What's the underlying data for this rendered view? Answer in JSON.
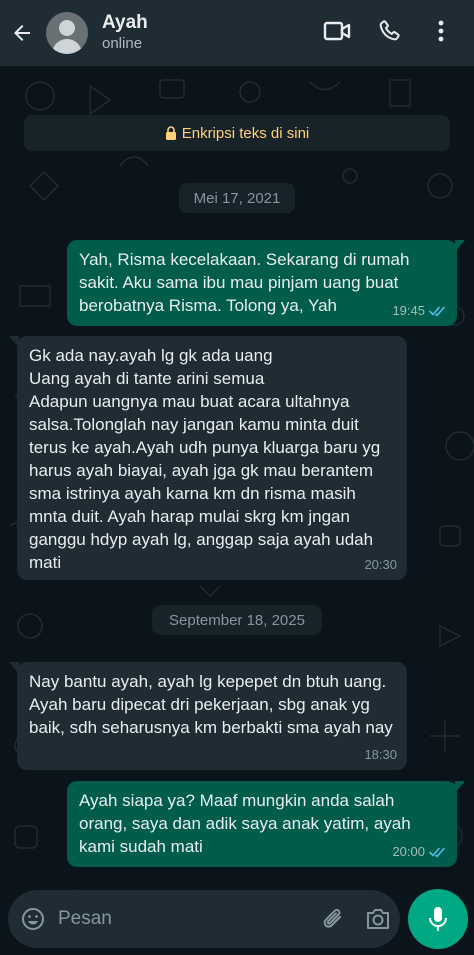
{
  "header": {
    "contact_name": "Ayah",
    "status": "online",
    "icons": [
      "back-arrow-icon",
      "video-call-icon",
      "voice-call-icon",
      "more-options-icon"
    ]
  },
  "encryption_notice": "Enkripsi teks di sini",
  "dates": {
    "first": "Mei 17, 2021",
    "second": "September 18, 2025"
  },
  "messages": [
    {
      "direction": "outgoing",
      "text": "Yah, Risma kecelakaan. Sekarang di rumah sakit. Aku sama ibu mau pinjam uang  buat berobatnya Risma. Tolong ya, Yah",
      "time": "19:45",
      "read": true
    },
    {
      "direction": "incoming",
      "text": "Gk ada nay.ayah lg gk ada uang\nUang ayah di tante arini semua\nAdapun uangnya mau buat acara ultahnya salsa.Tolonglah nay jangan kamu minta duit terus ke ayah.Ayah udh punya kluarga baru yg harus ayah biayai, ayah jga gk mau berantem sma istrinya ayah karna km dn risma masih mnta duit. Ayah harap mulai skrg km jngan ganggu hdyp ayah lg, anggap saja ayah udah mati",
      "time": "20:30"
    },
    {
      "direction": "incoming",
      "text": "Nay bantu ayah, ayah lg kepepet dn btuh uang. Ayah baru dipecat dri pekerjaan, sbg anak yg baik, sdh seharusnya km berbakti sma ayah nay",
      "time": "18:30"
    },
    {
      "direction": "outgoing",
      "text": "Ayah siapa ya? Maaf mungkin anda salah orang, saya dan adik saya anak yatim, ayah kami sudah mati",
      "time": "20:00",
      "read": true
    }
  ],
  "composer": {
    "placeholder": "Pesan",
    "icons": [
      "emoji-icon",
      "attach-icon",
      "camera-icon",
      "mic-icon"
    ]
  },
  "colors": {
    "header_bg": "#1f2c34",
    "chat_bg": "#0b141a",
    "outgoing_bubble": "#005c4b",
    "incoming_bubble": "#1f2c34",
    "accent": "#00a884",
    "read_ticks": "#53bdeb",
    "encryption_text": "#ffd279"
  }
}
